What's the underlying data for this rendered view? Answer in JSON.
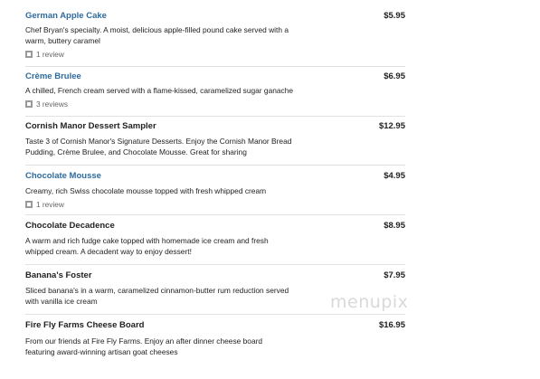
{
  "items": [
    {
      "name": "German Apple Cake",
      "price": "$5.95",
      "desc1": "Chef Bryan's specialty. A moist, delicious apple-filled pound cake served with a",
      "desc2": "warm, buttery caramel",
      "review": "1 review"
    },
    {
      "name": "Crème Brulee",
      "price": "$6.95",
      "desc1": "A chilled, French cream served with a flame-kissed, caramelized sugar ganache",
      "review": "3 reviews"
    },
    {
      "name": "Cornish Manor Dessert Sampler",
      "price": "$12.95",
      "desc1": "Taste 3 of Cornish Manor's Signature Desserts. Enjoy the Cornish Manor Bread",
      "desc2": "Pudding, Crème Brulee, and Chocolate Mousse. Great for sharing"
    },
    {
      "name": "Chocolate Mousse",
      "price": "$4.95",
      "desc1": "Creamy, rich Swiss chocolate mousse topped with fresh whipped cream",
      "review": "1 review"
    },
    {
      "name": "Chocolate Decadence",
      "price": "$8.95",
      "desc1": "A warm and rich fudge cake topped with homemade ice cream and fresh",
      "desc2": "whipped cream. A decadent way to enjoy dessert!"
    },
    {
      "name": "Banana's Foster",
      "price": "$7.95",
      "desc1": "Sliced banana's in a warm, caramelized cinnamon-butter rum reduction served",
      "desc2": "with vanilla ice cream"
    },
    {
      "name": "Fire Fly Farms Cheese Board",
      "price": "$16.95",
      "desc1": "From our friends at Fire Fly Farms. Enjoy an after dinner cheese board",
      "desc2": "featuring award-winning artisan goat cheeses"
    }
  ],
  "watermark": "menupix"
}
